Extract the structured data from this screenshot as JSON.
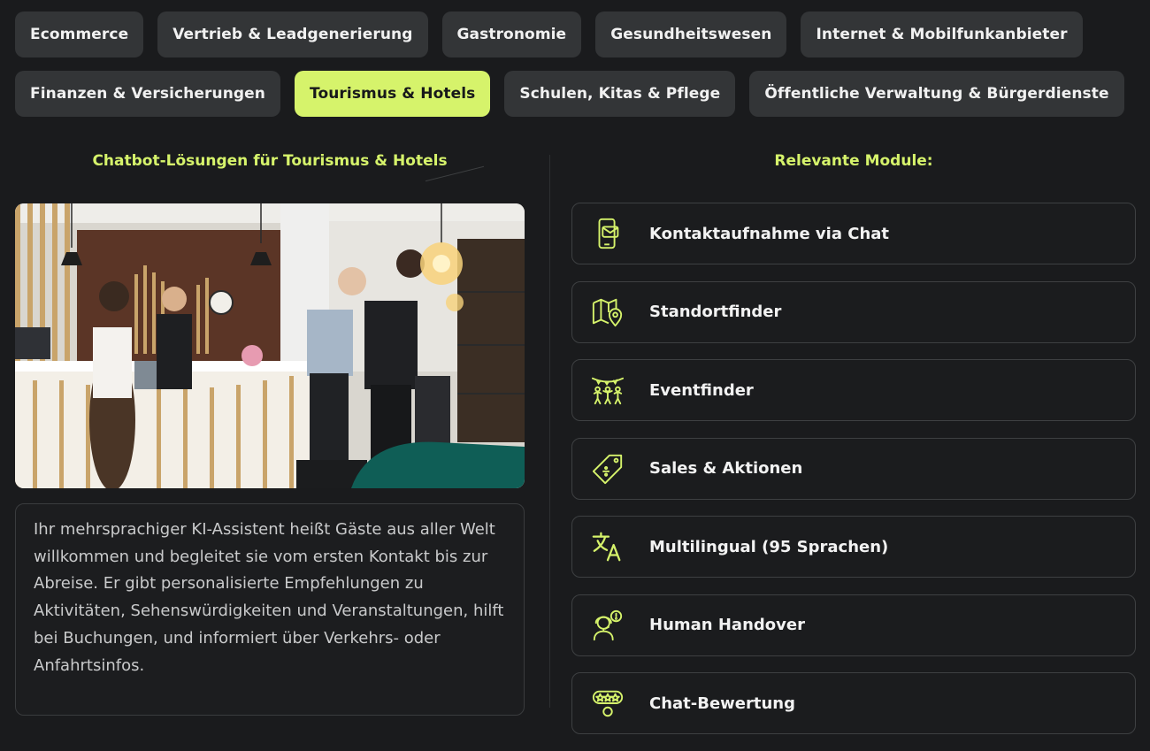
{
  "tabs": {
    "row1": [
      "Ecommerce",
      "Vertrieb & Leadgenerierung",
      "Gastronomie",
      "Gesundheitswesen",
      "Internet & Mobilfunkanbieter"
    ],
    "row2": [
      "Finanzen & Versicherungen",
      "Tourismus & Hotels",
      "Schulen, Kitas & Pflege",
      "Öffentliche Verwaltung & Bürgerdienste"
    ],
    "active": "Tourismus & Hotels"
  },
  "left": {
    "title": "Chatbot-Lösungen für Tourismus & Hotels",
    "description": "Ihr mehrsprachiger KI-Assistent heißt Gäste aus aller Welt willkommen und begleitet sie vom ersten Kontakt bis zur Abreise. Er gibt personalisierte Empfehlungen zu Aktivitäten, Sehenswürdigkeiten und Veranstaltungen, hilft bei Buchungen, und informiert über Verkehrs- oder Anfahrtsinfos."
  },
  "right": {
    "title": "Relevante Module:",
    "modules": [
      {
        "label": "Kontaktaufnahme via Chat",
        "icon": "phone-chat-icon"
      },
      {
        "label": "Standortfinder",
        "icon": "map-pin-icon"
      },
      {
        "label": "Eventfinder",
        "icon": "party-people-icon"
      },
      {
        "label": "Sales & Aktionen",
        "icon": "price-tag-icon"
      },
      {
        "label": "Multilingual (95 Sprachen)",
        "icon": "translate-icon"
      },
      {
        "label": "Human Handover",
        "icon": "support-agent-icon"
      },
      {
        "label": "Chat-Bewertung",
        "icon": "rating-stars-icon"
      }
    ]
  },
  "colors": {
    "accent": "#d6f36b",
    "background": "#1a1b1d",
    "tab": "#333537"
  }
}
